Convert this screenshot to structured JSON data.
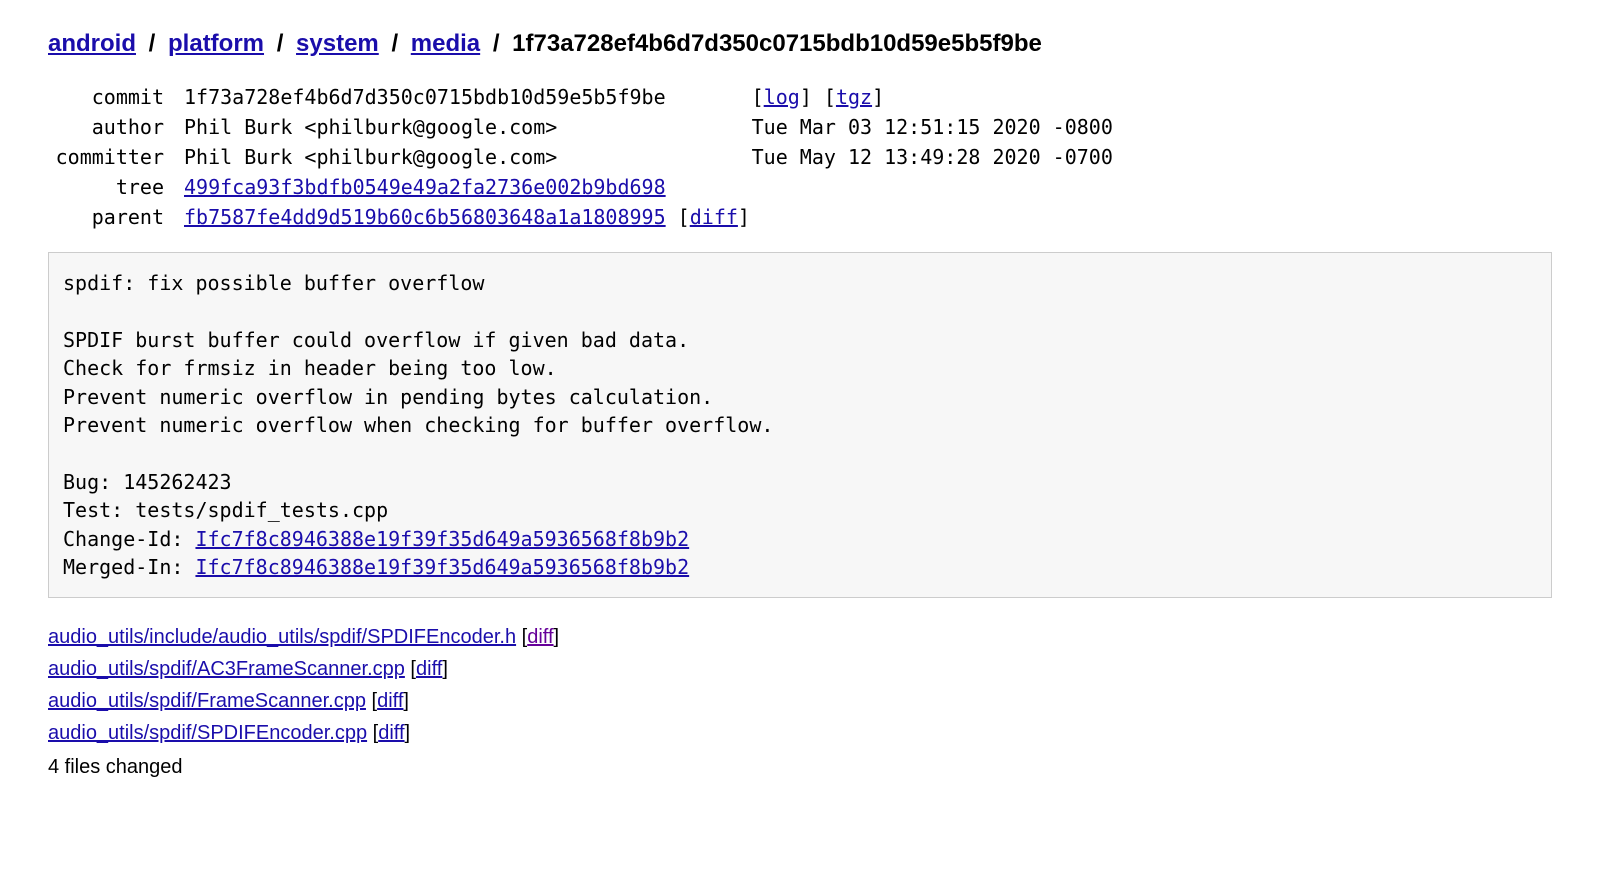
{
  "breadcrumb": {
    "parts": [
      "android",
      "platform",
      "system",
      "media"
    ],
    "hash": "1f73a728ef4b6d7d350c0715bdb10d59e5b5f9be",
    "sep": "/"
  },
  "meta": {
    "labels": {
      "commit": "commit",
      "author": "author",
      "committer": "committer",
      "tree": "tree",
      "parent": "parent"
    },
    "commit": "1f73a728ef4b6d7d350c0715bdb10d59e5b5f9be",
    "log": "log",
    "tgz": "tgz",
    "author": "Phil Burk <philburk@google.com>",
    "author_date": "Tue Mar 03 12:51:15 2020 -0800",
    "committer": "Phil Burk <philburk@google.com>",
    "committer_date": "Tue May 12 13:49:28 2020 -0700",
    "tree": "499fca93f3bdfb0549e49a2fa2736e002b9bd698",
    "parent": "fb7587fe4dd9d519b60c6b56803648a1a1808995",
    "parent_diff": "diff"
  },
  "message": {
    "title": "spdif: fix possible buffer overflow",
    "body1": "SPDIF burst buffer could overflow if given bad data.",
    "body2": "Check for frmsiz in header being too low.",
    "body3": "Prevent numeric overflow in pending bytes calculation.",
    "body4": "Prevent numeric overflow when checking for buffer overflow.",
    "bug_label": "Bug: 145262423",
    "test_label": "Test: tests/spdif_tests.cpp",
    "changeid_label": "Change-Id: ",
    "changeid": "Ifc7f8c8946388e19f39f35d649a5936568f8b9b2",
    "mergedin_label": "Merged-In: ",
    "mergedin": "Ifc7f8c8946388e19f39f35d649a5936568f8b9b2"
  },
  "files": [
    {
      "path": "audio_utils/include/audio_utils/spdif/SPDIFEncoder.h",
      "diff": "diff",
      "visited": true
    },
    {
      "path": "audio_utils/spdif/AC3FrameScanner.cpp",
      "diff": "diff",
      "visited": false
    },
    {
      "path": "audio_utils/spdif/FrameScanner.cpp",
      "diff": "diff",
      "visited": false
    },
    {
      "path": "audio_utils/spdif/SPDIFEncoder.cpp",
      "diff": "diff",
      "visited": false
    }
  ],
  "summary": "4 files changed"
}
